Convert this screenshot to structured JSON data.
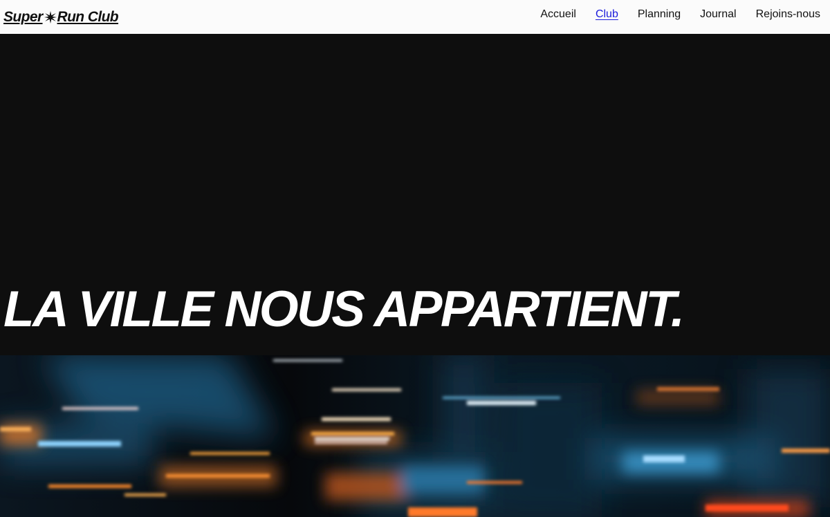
{
  "header": {
    "logo": {
      "part1": "Super",
      "part2": "Run Club",
      "icon": "starburst-icon"
    },
    "nav": [
      {
        "label": "Accueil",
        "active": false
      },
      {
        "label": "Club",
        "active": true
      },
      {
        "label": "Planning",
        "active": false
      },
      {
        "label": "Journal",
        "active": false
      },
      {
        "label": "Rejoins-nous",
        "active": false
      }
    ],
    "active_color": "#1a1adb"
  },
  "hero": {
    "title": "LA VILLE NOUS APPARTIENT.",
    "background": "#0e0e0e",
    "text_color": "#ffffff"
  },
  "photo": {
    "subject": "blurred-city-night-lights-image",
    "colors": [
      "#f2a23a",
      "#2b7fb0",
      "#e84a1c",
      "#ffffff"
    ]
  }
}
